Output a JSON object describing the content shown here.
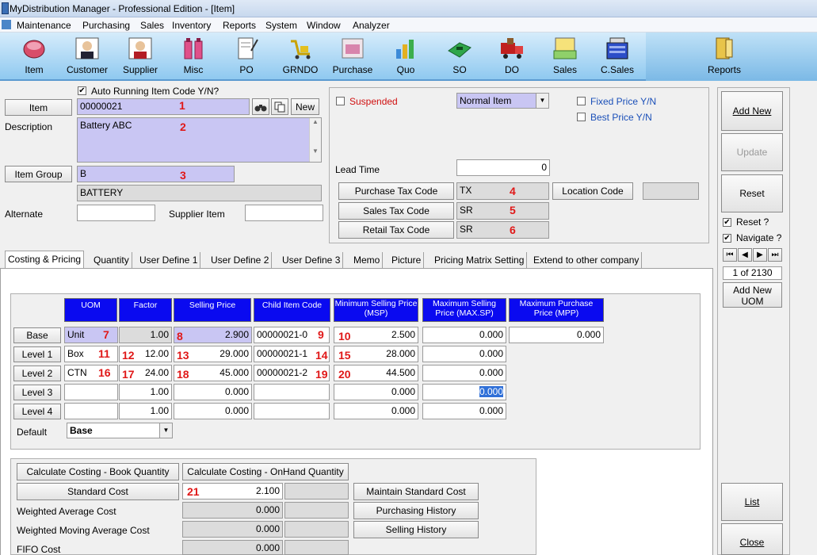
{
  "window": {
    "title": "MyDistribution Manager - Professional Edition - [Item]"
  },
  "menu": [
    "Maintenance",
    "Purchasing",
    "Sales",
    "Inventory",
    "Reports",
    "System",
    "Window",
    "Analyzer"
  ],
  "toolbar": [
    {
      "label": "Item",
      "icon": "item-icon"
    },
    {
      "label": "Customer",
      "icon": "customer-icon"
    },
    {
      "label": "Supplier",
      "icon": "supplier-icon"
    },
    {
      "label": "Misc",
      "icon": "misc-icon"
    },
    {
      "label": "PO",
      "icon": "po-icon"
    },
    {
      "label": "GRNDO",
      "icon": "grndo-icon"
    },
    {
      "label": "Purchase",
      "icon": "purchase-icon"
    },
    {
      "label": "Quo",
      "icon": "quo-icon"
    },
    {
      "label": "SO",
      "icon": "so-icon"
    },
    {
      "label": "DO",
      "icon": "do-icon"
    },
    {
      "label": "Sales",
      "icon": "sales-icon"
    },
    {
      "label": "C.Sales",
      "icon": "csales-icon"
    },
    {
      "label": "Reports",
      "icon": "reports-icon"
    }
  ],
  "form": {
    "auto_code_label": "Auto Running Item Code Y/N?",
    "item_label": "Item",
    "item_value": "00000021",
    "new_label": "New",
    "description_label": "Description",
    "description_value": "Battery ABC",
    "item_group_label": "Item Group",
    "item_group_value": "B",
    "item_group_desc": "BATTERY",
    "alternate_label": "Alternate",
    "supplier_item_label": "Supplier Item",
    "suspended_label": "Suspended",
    "item_type": "Normal Item",
    "fixed_price_label": "Fixed Price Y/N",
    "best_price_label": "Best Price Y/N",
    "lead_time_label": "Lead Time",
    "lead_time_value": "0",
    "purchase_tax_label": "Purchase Tax Code",
    "purchase_tax_value": "TX",
    "sales_tax_label": "Sales Tax Code",
    "sales_tax_value": "SR",
    "retail_tax_label": "Retail Tax Code",
    "retail_tax_value": "SR",
    "location_code_label": "Location Code"
  },
  "markers": [
    "1",
    "2",
    "3",
    "4",
    "5",
    "6",
    "7",
    "8",
    "9",
    "10",
    "11",
    "12",
    "13",
    "14",
    "15",
    "16",
    "17",
    "18",
    "19",
    "20",
    "21"
  ],
  "tabs": [
    "Costing & Pricing",
    "Quantity",
    "User Define 1",
    "User Define 2",
    "User Define 3",
    "Memo",
    "Picture",
    "Pricing Matrix Setting",
    "Extend to other company"
  ],
  "grid": {
    "headers": {
      "uom": "UOM",
      "factor": "Factor",
      "selling": "Selling Price",
      "child": "Child Item Code",
      "msp": "Minimum Selling Price (MSP)",
      "maxsp": "Maximum Selling Price (MAX.SP)",
      "mpp": "Maximum Purchase Price (MPP)"
    },
    "rows": [
      {
        "label": "Base",
        "uom": "Unit",
        "factor": "1.00",
        "selling": "2.900",
        "child": "00000021-0",
        "msp": "2.500",
        "maxsp": "0.000",
        "mpp": "0.000"
      },
      {
        "label": "Level 1",
        "uom": "Box",
        "factor": "12.00",
        "selling": "29.000",
        "child": "00000021-1",
        "msp": "28.000",
        "maxsp": "0.000"
      },
      {
        "label": "Level 2",
        "uom": "CTN",
        "factor": "24.00",
        "selling": "45.000",
        "child": "00000021-2",
        "msp": "44.500",
        "maxsp": "0.000"
      },
      {
        "label": "Level 3",
        "uom": "",
        "factor": "1.00",
        "selling": "0.000",
        "child": "",
        "msp": "0.000",
        "maxsp": "0.000"
      },
      {
        "label": "Level 4",
        "uom": "",
        "factor": "1.00",
        "selling": "0.000",
        "child": "",
        "msp": "0.000",
        "maxsp": "0.000"
      }
    ],
    "default_label": "Default",
    "default_value": "Base"
  },
  "costing": {
    "book_qty_btn": "Calculate Costing - Book Quantity",
    "onhand_qty_btn": "Calculate Costing - OnHand Quantity",
    "standard_cost_btn": "Standard Cost",
    "standard_cost_value": "2.100",
    "wac_label": "Weighted Average Cost",
    "wac_value": "0.000",
    "wmac_label": "Weighted Moving Average Cost",
    "wmac_value": "0.000",
    "fifo_label": "FIFO Cost",
    "fifo_value": "0.000",
    "maintain_btn": "Maintain Standard Cost",
    "purchasing_history_btn": "Purchasing History",
    "selling_history_btn": "Selling History"
  },
  "side": {
    "add_new": "Add New",
    "update": "Update",
    "reset": "Reset",
    "reset_check": "Reset ?",
    "navigate_check": "Navigate ?",
    "record_position": "1 of 2130",
    "add_new_uom": "Add New UOM",
    "list": "List",
    "close": "Close"
  }
}
